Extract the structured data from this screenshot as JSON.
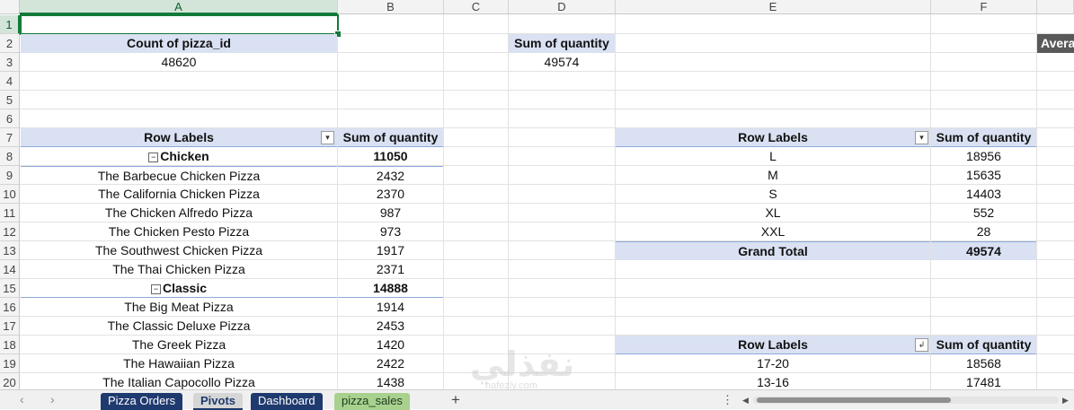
{
  "columns": [
    "A",
    "B",
    "C",
    "D",
    "E",
    "F"
  ],
  "rows": [
    "1",
    "2",
    "3",
    "4",
    "5",
    "6",
    "7",
    "8",
    "9",
    "10",
    "11",
    "12",
    "13",
    "14",
    "15",
    "16",
    "17",
    "18",
    "19",
    "20"
  ],
  "pivot_count": {
    "header": "Count of pizza_id",
    "value": "48620"
  },
  "pivot_sum": {
    "header": "Sum of quantity",
    "value": "49574"
  },
  "partial_header": "Avera",
  "pivot_category": {
    "row_labels": "Row Labels",
    "sum_header": "Sum of quantity",
    "rows": [
      {
        "label": "Chicken",
        "value": "11050",
        "group": true
      },
      {
        "label": "The Barbecue Chicken Pizza",
        "value": "2432"
      },
      {
        "label": "The California Chicken Pizza",
        "value": "2370"
      },
      {
        "label": "The Chicken Alfredo Pizza",
        "value": "987"
      },
      {
        "label": "The Chicken Pesto Pizza",
        "value": "973"
      },
      {
        "label": "The Southwest Chicken Pizza",
        "value": "1917"
      },
      {
        "label": "The Thai Chicken Pizza",
        "value": "2371"
      },
      {
        "label": "Classic",
        "value": "14888",
        "group": true
      },
      {
        "label": "The Big Meat Pizza",
        "value": "1914"
      },
      {
        "label": "The Classic Deluxe Pizza",
        "value": "2453"
      },
      {
        "label": "The Greek Pizza",
        "value": "1420"
      },
      {
        "label": "The Hawaiian Pizza",
        "value": "2422"
      },
      {
        "label": "The Italian Capocollo Pizza",
        "value": "1438"
      }
    ]
  },
  "pivot_size": {
    "row_labels": "Row Labels",
    "sum_header": "Sum of quantity",
    "rows": [
      {
        "label": "L",
        "value": "18956"
      },
      {
        "label": "M",
        "value": "15635"
      },
      {
        "label": "S",
        "value": "14403"
      },
      {
        "label": "XL",
        "value": "552"
      },
      {
        "label": "XXL",
        "value": "28"
      }
    ],
    "total_label": "Grand Total",
    "total_value": "49574"
  },
  "pivot_hour": {
    "row_labels": "Row Labels",
    "sum_header": "Sum of quantity",
    "rows": [
      {
        "label": "17-20",
        "value": "18568"
      },
      {
        "label": "13-16",
        "value": "17481"
      }
    ]
  },
  "icons": {
    "dropdown": "▾",
    "sort_dropdown": "↲",
    "collapse": "−",
    "prev": "‹",
    "next": "›",
    "more": "⋮",
    "add": "+"
  },
  "tabs": [
    {
      "label": "Pizza Orders",
      "style": "navy"
    },
    {
      "label": "Pivots",
      "style": "active"
    },
    {
      "label": "Dashboard",
      "style": "navy"
    },
    {
      "label": "pizza_sales",
      "style": "green"
    }
  ],
  "watermark": {
    "main": "نفذلي",
    "sub": "nafezly.com"
  },
  "colors": {
    "pivot_header": "#d9e1f2",
    "tab_navy": "#1f3a6e",
    "tab_green": "#a9d18e",
    "selection": "#137a3a"
  }
}
